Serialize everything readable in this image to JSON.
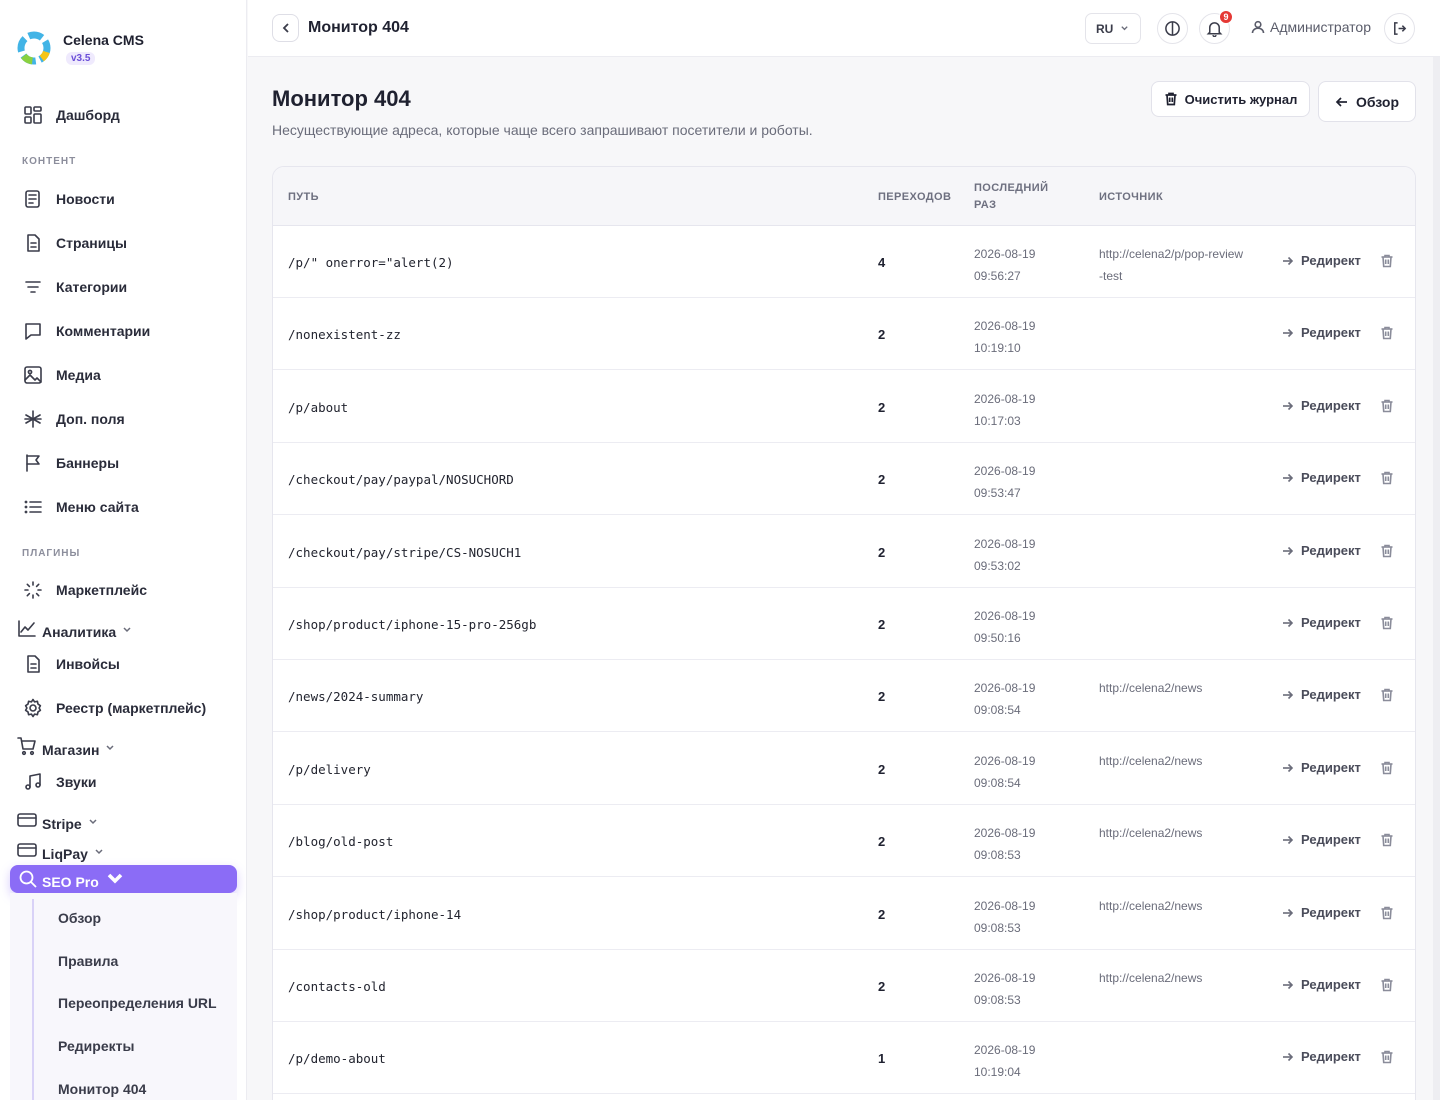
{
  "brand": {
    "name": "Celena CMS",
    "version": "v3.5"
  },
  "sidebar": {
    "dashboard": "Дашборд",
    "content_label": "КОНТЕНТ",
    "content_items": [
      "Новости",
      "Страницы",
      "Категории",
      "Комментарии",
      "Медиа",
      "Доп. поля",
      "Баннеры",
      "Меню сайта"
    ],
    "plugins_label": "ПЛАГИНЫ",
    "plugin_items": {
      "marketplace": "Маркетплейс",
      "analytics": "Аналитика",
      "invoices": "Инвойсы",
      "registry": "Реестр (маркетплейс)",
      "shop": "Магазин",
      "sounds": "Звуки",
      "stripe": "Stripe",
      "liqpay": "LiqPay",
      "seo_pro": "SEO Pro"
    },
    "seo_submenu": [
      "Обзор",
      "Правила",
      "Переопределения URL",
      "Редиректы",
      "Монитор 404"
    ]
  },
  "topbar": {
    "title": "Монитор 404",
    "lang": "RU",
    "notifications_count": "9",
    "user": "Администратор"
  },
  "page": {
    "title": "Монитор 404",
    "subtitle": "Несуществующие адреса, которые чаще всего запрашивают посетители и роботы.",
    "clear_button": "Очистить журнал",
    "overview_button": "Обзор"
  },
  "table": {
    "headers": {
      "path": "ПУТЬ",
      "hits": "ПЕРЕХОДОВ",
      "last_seen": "ПОСЛЕДНИЙ РАЗ",
      "source": "ИСТОЧНИК"
    },
    "redirect_label": "Редирект",
    "rows": [
      {
        "path": "/p/\" onerror=\"alert(2)",
        "hits": "4",
        "date": "2026-08-19",
        "time": "09:56:27",
        "source": "http://celena2/p/pop-review-test"
      },
      {
        "path": "/nonexistent-zz",
        "hits": "2",
        "date": "2026-08-19",
        "time": "10:19:10",
        "source": ""
      },
      {
        "path": "/p/about",
        "hits": "2",
        "date": "2026-08-19",
        "time": "10:17:03",
        "source": ""
      },
      {
        "path": "/checkout/pay/paypal/NOSUCHORD",
        "hits": "2",
        "date": "2026-08-19",
        "time": "09:53:47",
        "source": ""
      },
      {
        "path": "/checkout/pay/stripe/CS-NOSUCH1",
        "hits": "2",
        "date": "2026-08-19",
        "time": "09:53:02",
        "source": ""
      },
      {
        "path": "/shop/product/iphone-15-pro-256gb",
        "hits": "2",
        "date": "2026-08-19",
        "time": "09:50:16",
        "source": ""
      },
      {
        "path": "/news/2024-summary",
        "hits": "2",
        "date": "2026-08-19",
        "time": "09:08:54",
        "source": "http://celena2/news"
      },
      {
        "path": "/p/delivery",
        "hits": "2",
        "date": "2026-08-19",
        "time": "09:08:54",
        "source": "http://celena2/news"
      },
      {
        "path": "/blog/old-post",
        "hits": "2",
        "date": "2026-08-19",
        "time": "09:08:53",
        "source": "http://celena2/news"
      },
      {
        "path": "/shop/product/iphone-14",
        "hits": "2",
        "date": "2026-08-19",
        "time": "09:08:53",
        "source": "http://celena2/news"
      },
      {
        "path": "/contacts-old",
        "hits": "2",
        "date": "2026-08-19",
        "time": "09:08:53",
        "source": "http://celena2/news"
      },
      {
        "path": "/p/demo-about",
        "hits": "1",
        "date": "2026-08-19",
        "time": "10:19:04",
        "source": ""
      }
    ]
  }
}
